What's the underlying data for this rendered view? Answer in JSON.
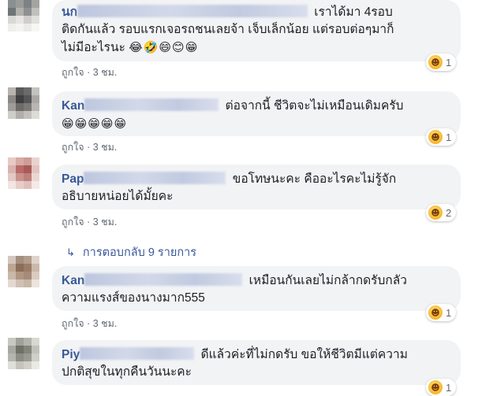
{
  "comments": [
    {
      "name": "นก",
      "text_line1": "เราได้มา 4รอบ",
      "text_line2": "ติดกันแล้ว รอบแรกเจอรถชนเลยจ้า เจ็บเล็กน้อย แต่รอบต่อๆมาก็",
      "text_line3": "ไม่มีอะไรนะ",
      "emojis": "😂🤣😄😊😁",
      "reaction_count": "1",
      "like_label": "ถูกใจ",
      "sep": "·",
      "time": "3 ชม."
    },
    {
      "name": "Kan",
      "text_line1": "ต่อจากนี้ ชีวิตจะไม่เหมือนเดิมครับ",
      "emojis": "😁😁😁😁😁",
      "reaction_count": "1",
      "like_label": "ถูกใจ",
      "sep": "·",
      "time": "3 ชม."
    },
    {
      "name": "Pap",
      "text_line1": "ขอโทษนะคะ คืออะไรคะไม่รู้จัก",
      "text_line2": "อธิบายหน่อยได้มั้ยคะ",
      "reaction_count": "2",
      "like_label": "ถูกใจ",
      "sep": "·",
      "time": "3 ชม.",
      "replies_label": "การตอบกลับ 9 รายการ"
    },
    {
      "name": "Kan",
      "text_line1": "เหมือนกันเลยไม่กล้ากดรับกลัว",
      "text_line2": "ความแรงส์ของนางมาก555",
      "reaction_count": "1",
      "like_label": "ถูกใจ",
      "sep": "·",
      "time": "3 ชม."
    },
    {
      "name": "Piy",
      "text_line1": "ดีแล้วค่ะที่ไม่กดรับ ขอให้ชีวิตมีแต่ความ",
      "text_line2": "ปกติสุขในทุกคืนวันนะคะ",
      "reaction_count": "1"
    }
  ],
  "icons": {
    "reaction": "haha-icon",
    "reply_arrow": "reply-arrow-icon"
  },
  "colors": {
    "name": "#385898",
    "bubble": "#f2f3f5",
    "meta": "#606770"
  }
}
